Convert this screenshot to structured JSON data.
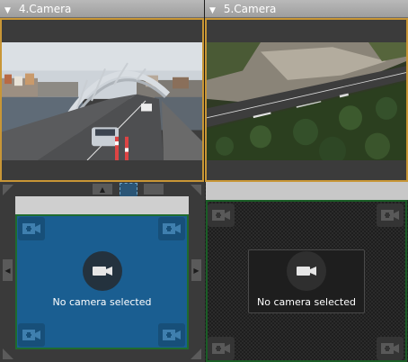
{
  "panes": {
    "top_left": {
      "title": "4.Camera"
    },
    "top_right": {
      "title": "5.Camera"
    }
  },
  "slots": {
    "left": {
      "message": "No camera selected"
    },
    "right": {
      "message": "No camera selected"
    }
  },
  "icons": {
    "collapse": "chevron-down-icon",
    "add_camera": "add-camera-icon",
    "camera": "camera-icon",
    "expand": "expand-icon"
  },
  "colors": {
    "active_border": "#c89636",
    "selected_slot": "#1a5e91",
    "slot_border": "#1a5d26"
  }
}
